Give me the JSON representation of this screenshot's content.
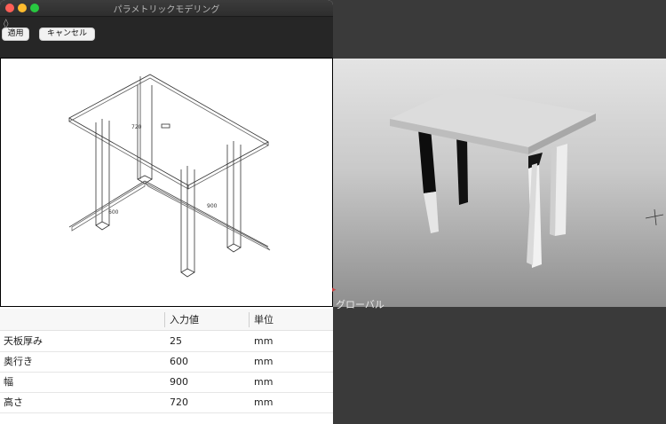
{
  "window": {
    "title": "パラメトリックモデリング"
  },
  "toolbar": {
    "handle": "◊",
    "apply_label": "適用",
    "cancel_label": "キャンセル"
  },
  "drawing": {
    "dim_height": "720",
    "dim_depth": "600",
    "dim_width": "900"
  },
  "grid": {
    "columns": [
      "",
      "入力値",
      "単位"
    ],
    "rows": [
      {
        "name": "天板厚み",
        "value": "25",
        "unit": "mm"
      },
      {
        "name": "奥行き",
        "value": "600",
        "unit": "mm"
      },
      {
        "name": "幅",
        "value": "900",
        "unit": "mm"
      },
      {
        "name": "高さ",
        "value": "720",
        "unit": "mm"
      }
    ]
  },
  "viewport": {
    "mode_label": "グローバル"
  },
  "colors": {
    "titlebar": "#2e2e2e",
    "close": "#ff5f57",
    "minimize": "#febc2e",
    "maximize": "#28c840",
    "viewport_bottom": "#8e8e8e"
  }
}
